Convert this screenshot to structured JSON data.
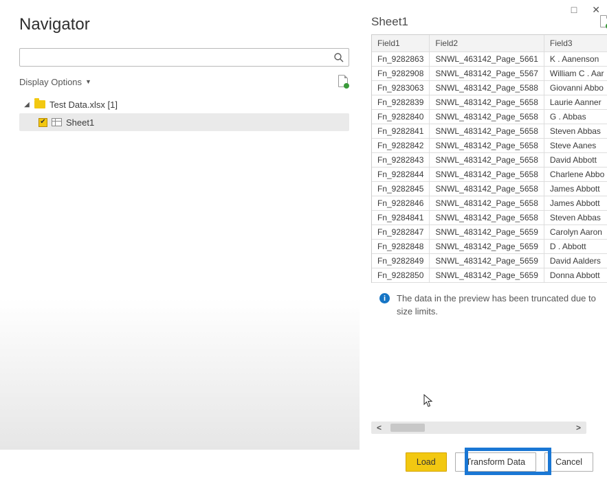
{
  "window": {
    "title": "Navigator",
    "maximize": "□",
    "close": "✕"
  },
  "search": {
    "placeholder": ""
  },
  "options_label": "Display Options",
  "tree": {
    "file_label": "Test Data.xlsx [1]",
    "sheet_label": "Sheet1"
  },
  "preview": {
    "title": "Sheet1"
  },
  "columns": [
    "Field1",
    "Field2",
    "Field3"
  ],
  "rows": [
    {
      "f1": "Fn_9282863",
      "f2": "SNWL_463142_Page_5661",
      "f3": "K . Aanenson"
    },
    {
      "f1": "Fn_9282908",
      "f2": "SNWL_483142_Page_5567",
      "f3": "William C . Aar"
    },
    {
      "f1": "Fn_9283063",
      "f2": "SNWL_483142_Page_5588",
      "f3": "Giovanni Abbo"
    },
    {
      "f1": "Fn_9282839",
      "f2": "SNWL_483142_Page_5658",
      "f3": "Laurie Aanner"
    },
    {
      "f1": "Fn_9282840",
      "f2": "SNWL_483142_Page_5658",
      "f3": "G . Abbas"
    },
    {
      "f1": "Fn_9282841",
      "f2": "SNWL_483142_Page_5658",
      "f3": "Steven Abbas"
    },
    {
      "f1": "Fn_9282842",
      "f2": "SNWL_483142_Page_5658",
      "f3": "Steve Aanes"
    },
    {
      "f1": "Fn_9282843",
      "f2": "SNWL_483142_Page_5658",
      "f3": "David Abbott"
    },
    {
      "f1": "Fn_9282844",
      "f2": "SNWL_483142_Page_5658",
      "f3": "Charlene Abbo"
    },
    {
      "f1": "Fn_9282845",
      "f2": "SNWL_483142_Page_5658",
      "f3": "James Abbott"
    },
    {
      "f1": "Fn_9282846",
      "f2": "SNWL_483142_Page_5658",
      "f3": "James Abbott"
    },
    {
      "f1": "Fn_9284841",
      "f2": "SNWL_483142_Page_5658",
      "f3": "Steven Abbas"
    },
    {
      "f1": "Fn_9282847",
      "f2": "SNWL_483142_Page_5659",
      "f3": "Carolyn Aaron"
    },
    {
      "f1": "Fn_9282848",
      "f2": "SNWL_483142_Page_5659",
      "f3": "D . Abbott"
    },
    {
      "f1": "Fn_9282849",
      "f2": "SNWL_483142_Page_5659",
      "f3": "David Aalders"
    },
    {
      "f1": "Fn_9282850",
      "f2": "SNWL_483142_Page_5659",
      "f3": "Donna Abbott"
    }
  ],
  "truncate_msg": "The data in the preview has been truncated due to size limits.",
  "buttons": {
    "load": "Load",
    "transform": "Transform Data",
    "cancel": "Cancel"
  }
}
